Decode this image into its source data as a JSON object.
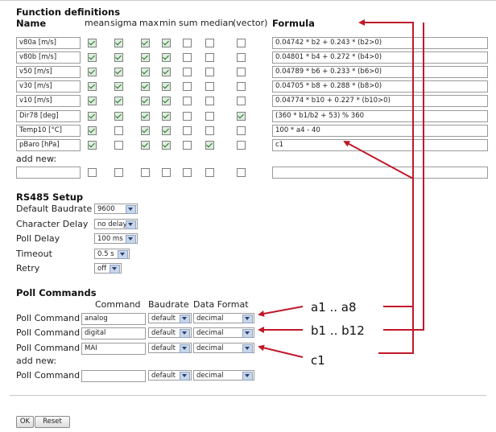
{
  "function_definitions": {
    "title": "Function definitions",
    "col_name": "Name",
    "col_formula": "Formula",
    "flag_headers": [
      "mean",
      "sigma",
      "max",
      "min",
      "sum",
      "median",
      "(vector)"
    ],
    "rows": [
      {
        "name": "v80a [m/s]",
        "flags": [
          true,
          true,
          true,
          true,
          false,
          false,
          false
        ],
        "formula": "0.04742 * b2 + 0.243 * (b2>0)"
      },
      {
        "name": "v80b [m/s]",
        "flags": [
          true,
          true,
          true,
          true,
          false,
          false,
          false
        ],
        "formula": "0.04801 * b4 + 0.272 * (b4>0)"
      },
      {
        "name": "v50 [m/s]",
        "flags": [
          true,
          true,
          true,
          true,
          false,
          false,
          false
        ],
        "formula": "0.04789 * b6 + 0.233 * (b6>0)"
      },
      {
        "name": "v30 [m/s]",
        "flags": [
          true,
          true,
          true,
          true,
          false,
          false,
          false
        ],
        "formula": "0.04705 * b8 + 0.288 * (b8>0)"
      },
      {
        "name": "v10 [m/s]",
        "flags": [
          true,
          true,
          true,
          true,
          false,
          false,
          false
        ],
        "formula": "0.04774 * b10 + 0.227 * (b10>0)"
      },
      {
        "name": "Dir78 [deg]",
        "flags": [
          true,
          true,
          true,
          true,
          false,
          false,
          true
        ],
        "formula": "(360 * b1/b2 + 53) % 360"
      },
      {
        "name": "Temp10 [°C]",
        "flags": [
          true,
          false,
          true,
          true,
          false,
          false,
          false
        ],
        "formula": "100 * a4 - 40"
      },
      {
        "name": "pBaro [hPa]",
        "flags": [
          true,
          false,
          true,
          true,
          false,
          true,
          false
        ],
        "formula": "c1"
      }
    ],
    "add_new_label": "add new:",
    "new_row": {
      "name": "",
      "flags": [
        false,
        false,
        false,
        false,
        false,
        false,
        false
      ],
      "formula": ""
    }
  },
  "rs485": {
    "title": "RS485 Setup",
    "fields": [
      {
        "label": "Default Baudrate",
        "value": "9600"
      },
      {
        "label": "Character Delay",
        "value": "no delay"
      },
      {
        "label": "Poll Delay",
        "value": "100 ms"
      },
      {
        "label": "Timeout",
        "value": "0.5 s"
      },
      {
        "label": "Retry",
        "value": "off"
      }
    ]
  },
  "poll": {
    "title": "Poll Commands",
    "headers": {
      "command": "Command",
      "baudrate": "Baudrate",
      "format": "Data Format"
    },
    "row_label": "Poll Command",
    "rows": [
      {
        "command": "analog",
        "baudrate": "default",
        "format": "decimal"
      },
      {
        "command": "digital",
        "baudrate": "default",
        "format": "decimal"
      },
      {
        "command": "MAI",
        "baudrate": "default",
        "format": "decimal"
      }
    ],
    "add_new_label": "add new:",
    "new_row": {
      "command": "",
      "baudrate": "default",
      "format": "decimal"
    }
  },
  "buttons": {
    "ok": "OK",
    "reset": "Reset"
  },
  "annotations": {
    "a": "a1 .. a8",
    "b": "b1 .. b12",
    "c": "c1"
  },
  "colors": {
    "arrow": "#c0182a",
    "checkbox_check": "#2a6a2a",
    "select_arrow": "#c8d6ea"
  }
}
